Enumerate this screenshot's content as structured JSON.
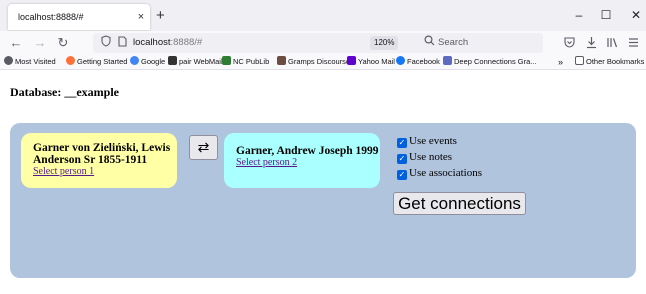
{
  "browser": {
    "tab_title": "localhost:8888/#",
    "tab_close": "×",
    "new_tab": "+",
    "window_controls": {
      "minimize": "–",
      "maximize": "☐",
      "close": "✕"
    },
    "nav": {
      "back": "←",
      "forward": "→",
      "reload": "↻"
    },
    "url": {
      "host": "localhost",
      "rest": ":8888/#"
    },
    "zoom": "120%",
    "search_placeholder": "Search",
    "bookmarks": [
      {
        "label": "Most Visited",
        "icon": "gear-icon",
        "color": "#5b5b66"
      },
      {
        "label": "Getting Started",
        "icon": "firefox-icon",
        "color": "#ff7139"
      },
      {
        "label": "Google",
        "icon": "google-icon",
        "color": "#4285f4"
      },
      {
        "label": "pair WebMail",
        "icon": "pair-icon",
        "color": "#333333"
      },
      {
        "label": "NC PubLib",
        "icon": "nc-icon",
        "color": "#2e7d32"
      },
      {
        "label": "Gramps Discourse",
        "icon": "gramps-icon",
        "color": "#6d4c41"
      },
      {
        "label": "Yahoo Mail",
        "icon": "yahoo-icon",
        "color": "#6001d2"
      },
      {
        "label": "Facebook",
        "icon": "facebook-icon",
        "color": "#1877f2"
      },
      {
        "label": "Deep Connections Gra...",
        "icon": "deep-connections-icon",
        "color": "#5c6bc0"
      }
    ],
    "overflow": "»",
    "other_bookmarks": "Other Bookmarks"
  },
  "page": {
    "database_label": "Database: __example",
    "person1": {
      "name": "Garner von Zieliński, Lewis Anderson Sr 1855-1911",
      "link": "Select person 1"
    },
    "person2": {
      "name": "Garner, Andrew Joseph 1999",
      "link": "Select person 2"
    },
    "swap_label": "⇄",
    "options": [
      {
        "label": "Use events",
        "checked": true
      },
      {
        "label": "Use notes",
        "checked": true
      },
      {
        "label": "Use associations",
        "checked": true
      }
    ],
    "get_connections_label": "Get connections",
    "colors": {
      "panel": "#b0c4de",
      "person1_bg": "#ffffa5",
      "person2_bg": "#aaffff",
      "link": "#551a8b",
      "checkbox": "#0060df"
    }
  }
}
